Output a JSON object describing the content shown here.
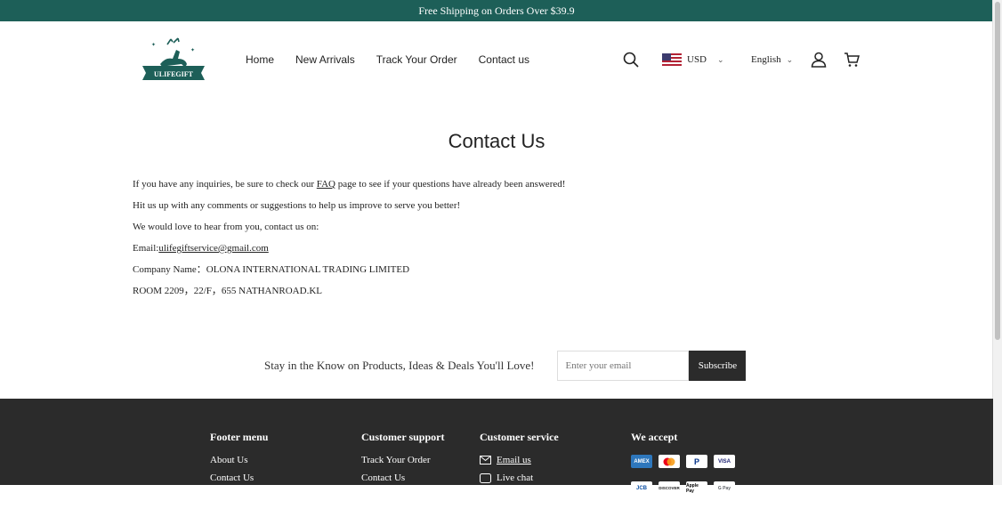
{
  "announcement": "Free Shipping on Orders Over $39.9",
  "logo": {
    "text": "ULIFEGIFT"
  },
  "nav": [
    "Home",
    "New Arrivals",
    "Track Your Order",
    "Contact us"
  ],
  "currency": {
    "code": "USD"
  },
  "language": "English",
  "page": {
    "title": "Contact Us",
    "line1_before": "If you have any inquiries, be sure to check our ",
    "line1_link": "FAQ",
    "line1_after": " page to see if your questions have already been answered!",
    "line2": "Hit us up with any comments or suggestions to help us improve to serve you better!",
    "line3": "We would love to hear from you, contact us on:",
    "email_label": "Email:",
    "email": "ulifegiftservice@gmail.com",
    "company": "Company Name：OLONA INTERNATIONAL TRADING LIMITED",
    "address": "ROOM 2209，22/F，655 NATHANROAD.KL"
  },
  "newsletter": {
    "text": "Stay in the Know on Products, Ideas & Deals You'll Love!",
    "placeholder": "Enter your email",
    "button": "Subscribe"
  },
  "footer": {
    "menu": {
      "title": "Footer menu",
      "items": [
        "About Us",
        "Contact Us"
      ]
    },
    "support": {
      "title": "Customer support",
      "items": [
        "Track Your Order",
        "Contact Us"
      ]
    },
    "service": {
      "title": "Customer service",
      "email": "Email us",
      "chat": "Live chat"
    },
    "accept": {
      "title": "We accept",
      "methods": [
        "AMEX",
        "Mastercard",
        "PayPal",
        "VISA",
        "JCB",
        "DISCOVER",
        "Apple Pay",
        "G Pay"
      ]
    }
  },
  "colors": {
    "announce_bg": "#1d5f58",
    "footer_bg": "#2b2b2b",
    "brand_green": "#1d5f58"
  }
}
